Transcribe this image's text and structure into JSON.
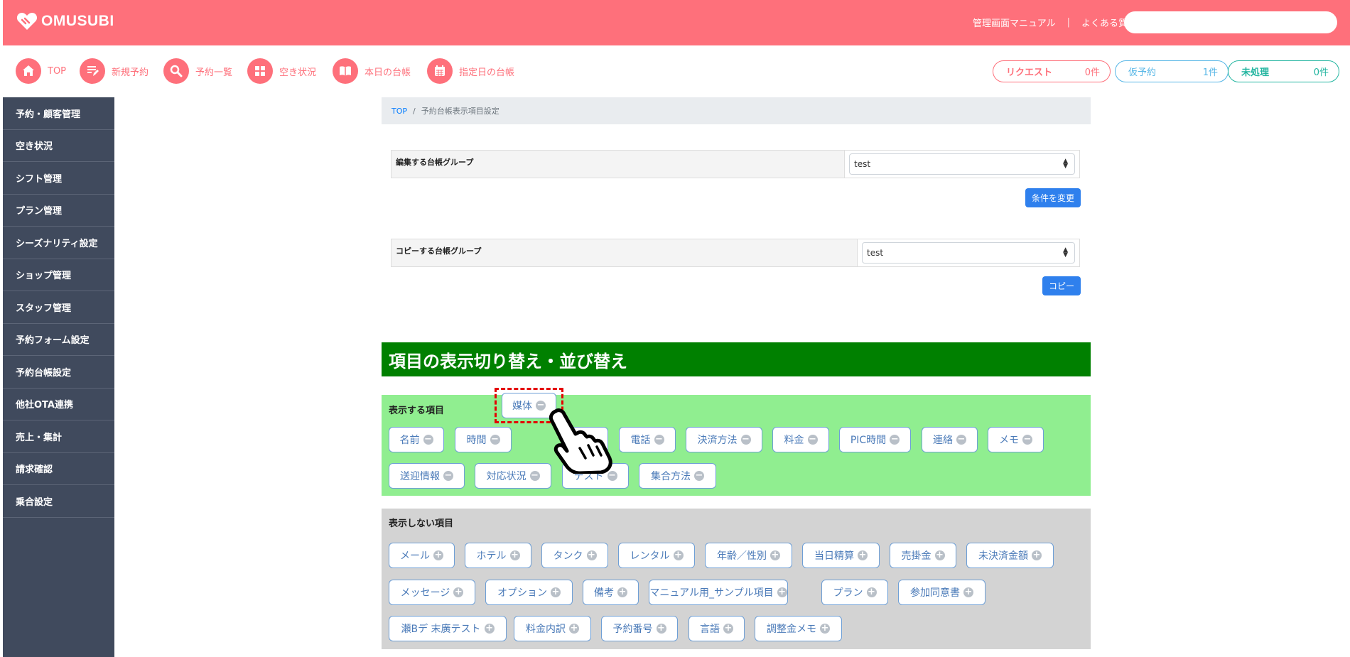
{
  "header": {
    "logo_text": "OMUSUBI",
    "links": [
      "管理画面マニュアル",
      "よくある質問"
    ],
    "search_placeholder": ""
  },
  "nav": {
    "items": [
      {
        "label": "TOP",
        "icon": "home-icon"
      },
      {
        "label": "新規予約",
        "icon": "new-reservation-icon"
      },
      {
        "label": "予約一覧",
        "icon": "search-icon"
      },
      {
        "label": "空き状況",
        "icon": "grid-icon"
      },
      {
        "label": "本日の台帳",
        "icon": "book-icon"
      },
      {
        "label": "指定日の台帳",
        "icon": "calendar-icon"
      }
    ],
    "badges": [
      {
        "label": "リクエスト",
        "count": "0件",
        "color": "#fe707b"
      },
      {
        "label": "仮予約",
        "count": "1件",
        "color": "#56b6e6"
      },
      {
        "label": "未処理",
        "count": "0件",
        "color": "#22b5a0"
      }
    ]
  },
  "sidebar": {
    "items": [
      "予約・顧客管理",
      "空き状況",
      "シフト管理",
      "プラン管理",
      "シーズナリティ設定",
      "ショップ管理",
      "スタッフ管理",
      "予約フォーム設定",
      "予約台帳設定",
      "他社OTA連携",
      "売上・集計",
      "請求確認",
      "乗合設定"
    ]
  },
  "breadcrumb": {
    "home": "TOP",
    "current": "予約台帳表示項目設定"
  },
  "edit_group": {
    "label": "編集する台帳グループ",
    "value": "test",
    "button": "条件を変更"
  },
  "copy_group": {
    "label": "コピーする台帳グループ",
    "value": "test",
    "button": "コピー"
  },
  "section_title": "項目の表示切り替え・並び替え",
  "shown": {
    "label": "表示する項目",
    "dragging": "媒体",
    "items": [
      "名前",
      "時間",
      "",
      "電話",
      "決済方法",
      "料金",
      "PIC時間",
      "連絡",
      "メモ",
      "送迎情報",
      "対応状況",
      "テスト",
      "集合方法"
    ]
  },
  "hidden": {
    "label": "表示しない項目",
    "items": [
      "メール",
      "ホテル",
      "タンク",
      "レンタル",
      "年齢／性別",
      "当日精算",
      "売掛金",
      "未決済金額",
      "メッセージ",
      "オプション",
      "備考",
      "マニュアル用_サンプル項目",
      "プラン",
      "参加同意書",
      "瀬Bデ 末廣テスト",
      "料金内訳",
      "予約番号",
      "言語",
      "調整金メモ"
    ]
  },
  "colors": {
    "header": "#fe707b",
    "sidebar": "#404a5d",
    "green": "#008000",
    "light_green": "#90ee90",
    "gray_box": "#d3d3d3",
    "button": "#2f80ed"
  }
}
